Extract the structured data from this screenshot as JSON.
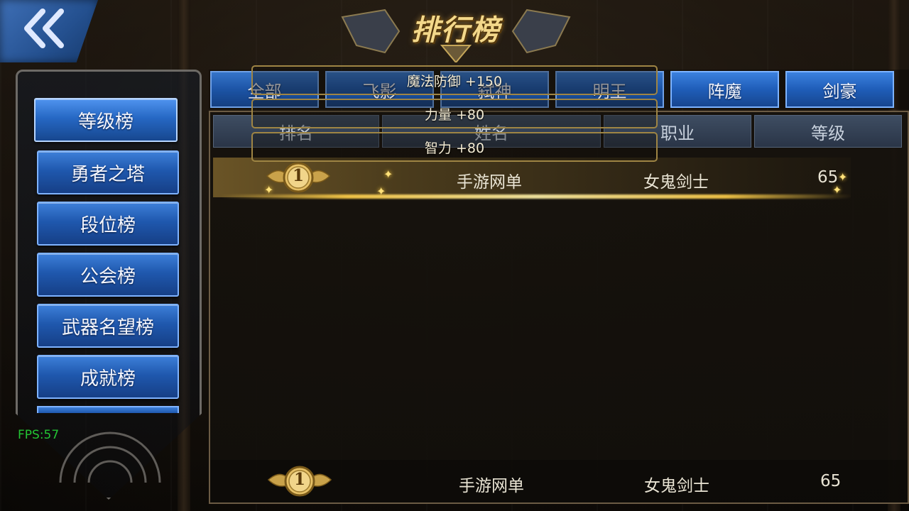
{
  "header": {
    "title": "排行榜"
  },
  "fps": "FPS:57",
  "sidebar": {
    "items": [
      {
        "label": "等级榜"
      },
      {
        "label": "勇者之塔"
      },
      {
        "label": "段位榜"
      },
      {
        "label": "公会榜"
      },
      {
        "label": "武器名望榜"
      },
      {
        "label": "成就榜"
      }
    ]
  },
  "tabs": [
    {
      "label": "全部"
    },
    {
      "label": "飞影"
    },
    {
      "label": "弑神"
    },
    {
      "label": "明王"
    },
    {
      "label": "阵魔"
    },
    {
      "label": "剑豪"
    }
  ],
  "columns": [
    {
      "label": "排名"
    },
    {
      "label": "姓名"
    },
    {
      "label": "职业"
    },
    {
      "label": "等级"
    }
  ],
  "rows": [
    {
      "rank": "1",
      "name": "手游网单",
      "class": "女鬼剑士",
      "level": "65"
    }
  ],
  "my_row": {
    "rank": "1",
    "name": "手游网单",
    "class": "女鬼剑士",
    "level": "65"
  },
  "attributes": [
    {
      "text": "魔法防御 +150"
    },
    {
      "text": "力量 +80"
    },
    {
      "text": "智力 +80"
    }
  ],
  "colors": {
    "accent_blue": "#1f5db8",
    "gold": "#f3d88a",
    "fps_green": "#23c434"
  }
}
